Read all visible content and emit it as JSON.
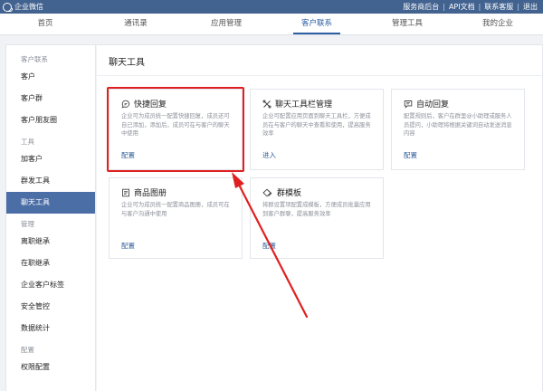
{
  "topbar": {
    "brand": "企业微信",
    "links": [
      "服务商后台",
      "API文档",
      "联系客服",
      "退出"
    ]
  },
  "nav": {
    "tabs": [
      "首页",
      "通讯录",
      "应用管理",
      "客户联系",
      "管理工具",
      "我的企业"
    ],
    "active_index": 3
  },
  "sidebar": {
    "group_1": "客户联系",
    "item_customer": "客户",
    "item_group": "客户群",
    "item_moments": "客户朋友圈",
    "group_2": "工具",
    "item_add": "加客户",
    "item_mass": "群发工具",
    "item_chat": "聊天工具",
    "group_3": "管理",
    "item_resign": "离职继承",
    "item_onjob": "在职继承",
    "item_tags": "企业客户标签",
    "item_security": "安全管控",
    "item_stats": "数据统计",
    "group_4": "配置",
    "item_perm": "权限配置"
  },
  "content": {
    "title": "聊天工具",
    "cards": [
      {
        "title": "快捷回复",
        "desc": "企业可为成员统一配置快捷回复，成员还可自己添加，添加后，成员可在与客户的聊天中使用",
        "action": "配置",
        "icon": "chat-bubble-icon"
      },
      {
        "title": "聊天工具栏管理",
        "desc": "企业可配置应用页面到聊天工具栏，方便成员在与客户的聊天中查看和使用，提高服务效率",
        "action": "进入",
        "icon": "toolbar-cross-icon"
      },
      {
        "title": "自动回复",
        "desc": "配置规则后，客户在群里@小助理或服务人员提问，小助理将根据关键词自动发送消息内容",
        "action": "配置",
        "icon": "auto-reply-icon"
      },
      {
        "title": "商品图册",
        "desc": "企业可为成员统一配置商品图册，成员可在与客户沟通中使用",
        "action": "配置",
        "icon": "product-album-icon"
      },
      {
        "title": "群模板",
        "desc": "将群设置项配置成模板，方便成员批量应用到客户群聊，提高服务效率",
        "action": "配置",
        "icon": "group-template-icon"
      }
    ]
  },
  "annotation": {
    "color": "#e02020"
  },
  "colors": {
    "brand_bar": "#42628f",
    "active": "#4c6ea6",
    "link": "#2d5b97"
  }
}
